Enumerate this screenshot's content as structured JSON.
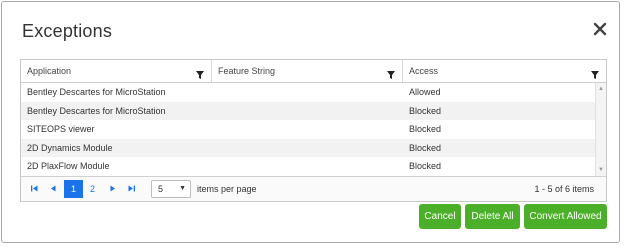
{
  "dialog": {
    "title": "Exceptions",
    "close_icon": "close-icon"
  },
  "grid": {
    "columns": [
      {
        "label": "Application",
        "filter_icon": "filter-icon"
      },
      {
        "label": "Feature String",
        "filter_icon": "filter-icon"
      },
      {
        "label": "Access",
        "filter_icon": "filter-icon"
      }
    ],
    "rows": [
      {
        "application": "Bentley Descartes for MicroStation",
        "feature_string": "",
        "access": "Allowed"
      },
      {
        "application": "Bentley Descartes for MicroStation",
        "feature_string": "",
        "access": "Blocked"
      },
      {
        "application": "SITEOPS viewer",
        "feature_string": "",
        "access": "Blocked"
      },
      {
        "application": "2D Dynamics Module",
        "feature_string": "",
        "access": "Blocked"
      },
      {
        "application": "2D PlaxFlow Module",
        "feature_string": "",
        "access": "Blocked"
      }
    ]
  },
  "pager": {
    "pages": [
      "1",
      "2"
    ],
    "current_page": "1",
    "page_size": "5",
    "items_per_page_label": "items per page",
    "info": "1 - 5 of 6 items",
    "icons": [
      "first-page-icon",
      "prev-page-icon",
      "next-page-icon",
      "last-page-icon",
      "chevron-down-icon"
    ]
  },
  "buttons": {
    "cancel": "Cancel",
    "delete_all": "Delete All",
    "convert_allowed": "Convert Allowed"
  },
  "colors": {
    "accent": "#1a73e8",
    "button_green": "#4caf29",
    "row_alt": "#f2f2f2"
  }
}
